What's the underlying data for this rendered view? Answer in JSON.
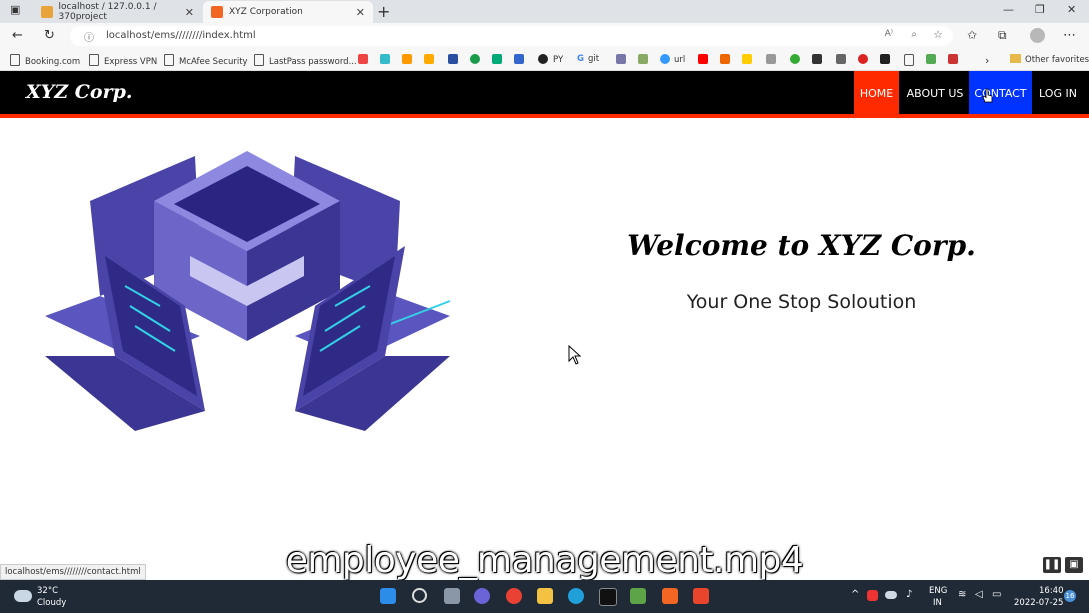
{
  "browser": {
    "tabs": [
      {
        "label": "localhost / 127.0.0.1 / 370project",
        "active": false
      },
      {
        "label": "XYZ Corporation",
        "active": true
      }
    ],
    "address": "localhost/ems////////index.html",
    "bookmarks": [
      "Booking.com",
      "Express VPN",
      "McAfee Security",
      "LastPass password...",
      "PY",
      "git",
      "url"
    ],
    "other_favorites": "Other favorites",
    "status_url": "localhost/ems////////contact.html"
  },
  "site": {
    "brand": "XYZ Corp.",
    "nav": [
      {
        "label": "HOME",
        "bg": "#ff2a00"
      },
      {
        "label": "ABOUT US",
        "bg": "#000000"
      },
      {
        "label": "CONTACT",
        "bg": "#0033ff"
      },
      {
        "label": "LOG IN",
        "bg": "#000000"
      }
    ],
    "welcome": "Welcome to XYZ Corp.",
    "tagline": "Your One Stop Soloution"
  },
  "video_caption": "employee_management.mp4",
  "taskbar": {
    "weather_temp": "32°C",
    "weather_desc": "Cloudy",
    "lang_top": "ENG",
    "lang_bottom": "IN",
    "time": "16:40",
    "date": "2022-07-25",
    "notif_count": "16"
  },
  "colors": {
    "nav_bg": "#000000",
    "accent_red": "#ff2a00",
    "accent_blue": "#0033ff",
    "illustration": "#4a44a8"
  }
}
